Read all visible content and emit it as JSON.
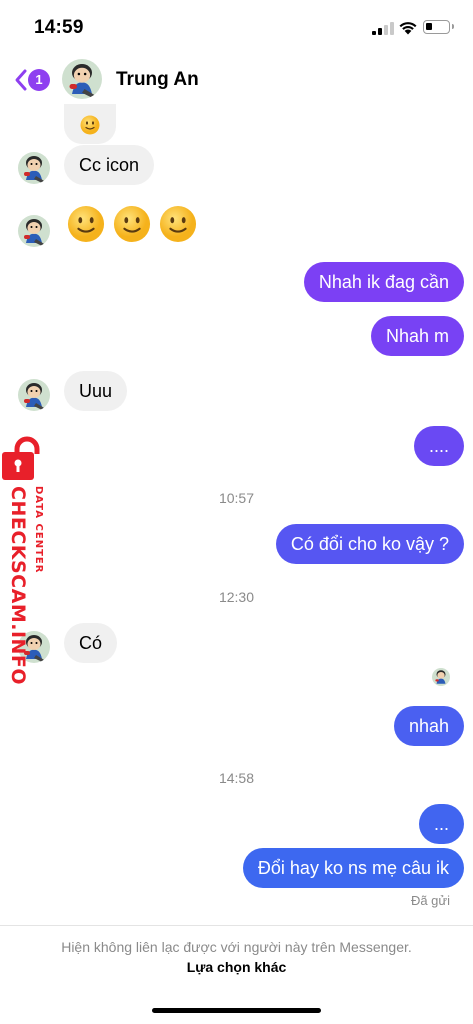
{
  "status_bar": {
    "time": "14:59",
    "battery_level": 0.2
  },
  "header": {
    "back_count": "1",
    "contact_name": "Trung An"
  },
  "colors": {
    "out_top": "#7c40f4",
    "out_bottom": "#3b6bf0",
    "in_bubble": "#f0f0f0",
    "accent": "#8e3ff0"
  },
  "messages": [
    {
      "dir": "in",
      "text": "Cc icon"
    },
    {
      "dir": "out",
      "text": "Nhah ik đag cần"
    },
    {
      "dir": "out",
      "text": "Nhah m"
    },
    {
      "dir": "in",
      "text": "Uuu"
    },
    {
      "dir": "out",
      "text": "...."
    },
    {
      "dir": "out",
      "text": "Có đổi cho ko vậy ?"
    },
    {
      "dir": "in",
      "text": "Có"
    },
    {
      "dir": "out",
      "text": "nhah"
    },
    {
      "dir": "out",
      "text": "..."
    },
    {
      "dir": "out",
      "text": "Đổi hay ko ns mẹ câu ik"
    }
  ],
  "timestamps": [
    "10:57",
    "12:30",
    "14:58"
  ],
  "sent_status": "Đã gửi",
  "watermark": {
    "main": "CHECKSCAM.INFO",
    "sub": "DATA CENTER"
  },
  "footer": {
    "note": "Hiện không liên lạc được với người này trên Messenger.",
    "link": "Lựa chọn khác"
  }
}
